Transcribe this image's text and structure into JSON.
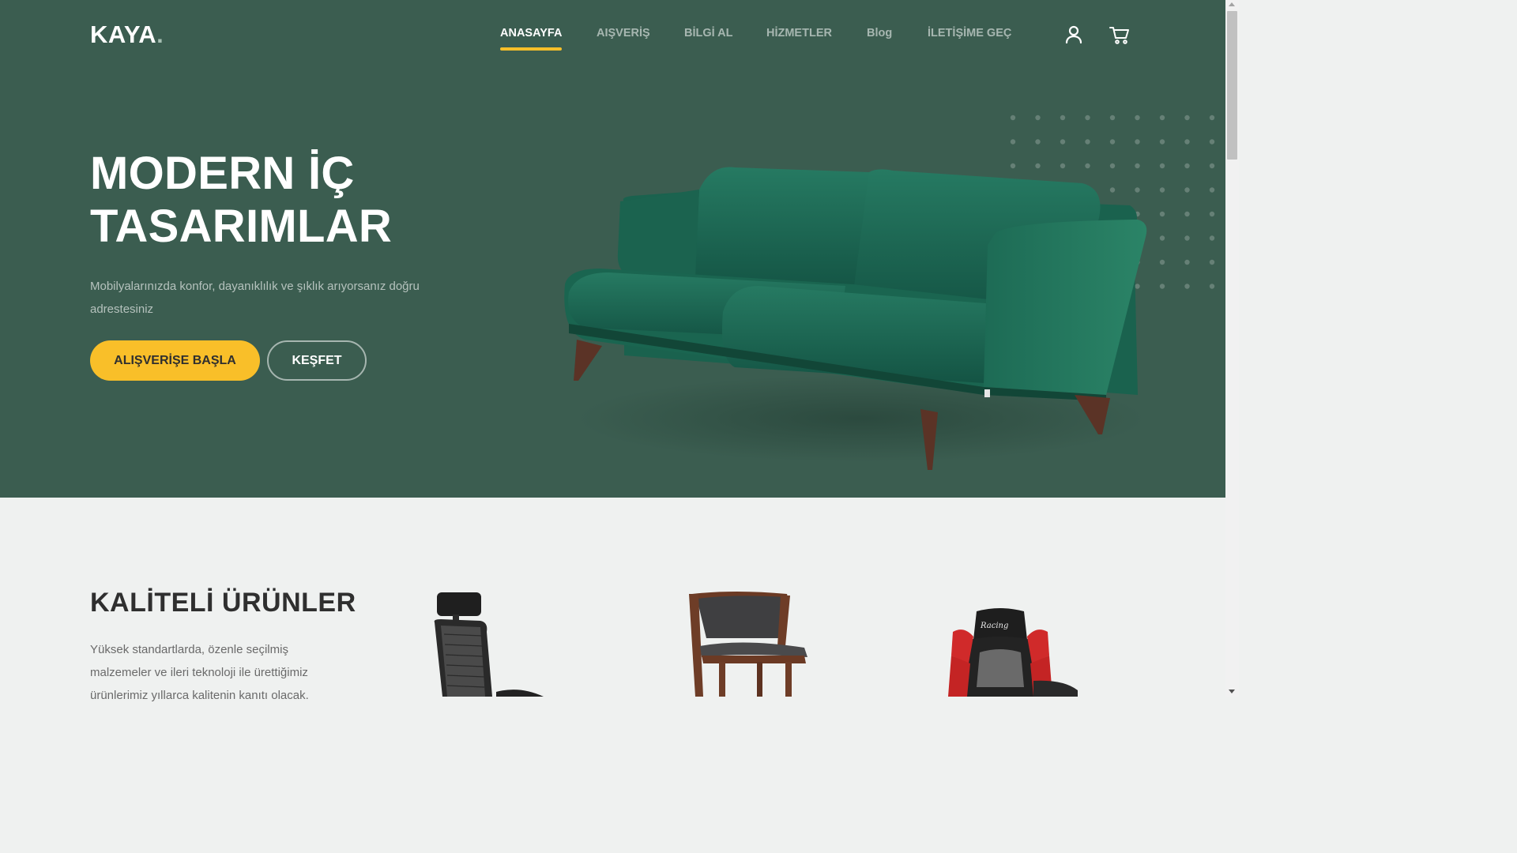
{
  "brand": {
    "name": "KAYA",
    "dot": "."
  },
  "nav": {
    "items": [
      {
        "label": "ANASAYFA",
        "active": true
      },
      {
        "label": "AIŞVERİŞ",
        "active": false
      },
      {
        "label": "BİLGİ AL",
        "active": false
      },
      {
        "label": "HİZMETLER",
        "active": false
      },
      {
        "label": "Blog",
        "active": false
      },
      {
        "label": "İLETİŞİME GEÇ",
        "active": false
      }
    ],
    "icons": [
      "user-icon",
      "cart-icon"
    ]
  },
  "hero": {
    "title_line1": "MODERN İÇ",
    "title_line2": "TASARIMLAR",
    "description": "Mobilyalarınızda konfor, dayanıklılık ve şıklık arıyorsanız doğru adrestesiniz",
    "primary_cta": "ALIŞVERİŞE BAŞLA",
    "secondary_cta": "KEŞFET"
  },
  "products_section": {
    "title": "KALİTELİ ÜRÜNLER",
    "description": "Yüksek standartlarda, özenle seçilmiş malzemeler ve ileri teknoloji ile ürettiğimiz ürünlerimiz yıllarca kalitenin kanıtı olacak.",
    "products": [
      {
        "name": "office-chair",
        "image": "mesh-office-chair"
      },
      {
        "name": "wooden-chair",
        "image": "wooden-dining-chair"
      },
      {
        "name": "gaming-chair",
        "image": "racing-gaming-chair"
      }
    ]
  },
  "colors": {
    "hero_bg": "#3b5d50",
    "accent": "#f9bf29",
    "page_bg": "#eff1f0",
    "sofa": "#1f6a55"
  }
}
